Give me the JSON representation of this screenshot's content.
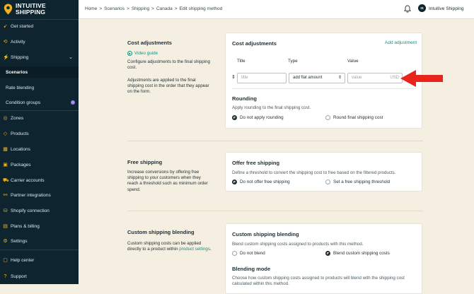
{
  "brand": {
    "name_line1": "INTUITIVE",
    "name_line2": "SHIPPING"
  },
  "sidebar": {
    "items": [
      {
        "label": "Get started",
        "icon": "rocket-icon"
      },
      {
        "label": "Activity",
        "icon": "activity-icon"
      },
      {
        "label": "Shipping",
        "icon": "shipping-icon"
      },
      {
        "label": "Scenarios"
      },
      {
        "label": "Rate blending"
      },
      {
        "label": "Condition groups",
        "badge": "i"
      },
      {
        "label": "Zones",
        "icon": "zones-icon"
      },
      {
        "label": "Products",
        "icon": "products-icon"
      },
      {
        "label": "Locations",
        "icon": "locations-icon"
      },
      {
        "label": "Packages",
        "icon": "packages-icon"
      },
      {
        "label": "Carrier accounts",
        "icon": "carrier-icon"
      },
      {
        "label": "Partner integrations",
        "icon": "partner-icon"
      },
      {
        "label": "Shopify connection",
        "icon": "shopify-icon"
      },
      {
        "label": "Plans & billing",
        "icon": "billing-icon"
      },
      {
        "label": "Settings",
        "icon": "gear-icon"
      },
      {
        "label": "Help center",
        "icon": "help-icon"
      },
      {
        "label": "Support",
        "icon": "support-icon"
      }
    ]
  },
  "header": {
    "breadcrumb": [
      "Home",
      "Scenarios",
      "Shipping",
      "Canada",
      "Edit shipping method"
    ],
    "sep": ">",
    "avatar": "IS",
    "user": "Intuitive Shipping"
  },
  "cost": {
    "title": "Cost adjustments",
    "video": "Video guide",
    "desc1": "Configure adjustments to the final shipping cost.",
    "desc2": "Adjustments are applied to the final shipping cost in the order that they appear on the form.",
    "card_title": "Cost adjustments",
    "add": "Add adjustment",
    "col_title": "Title",
    "col_type": "Type",
    "col_value": "Value",
    "title_ph": "title",
    "type_val": "add flat amount",
    "value_ph": "value",
    "unit": "USD",
    "rounding_title": "Rounding",
    "rounding_sub": "Apply rounding to the final shipping cost.",
    "r1": "Do not apply rounding",
    "r2": "Round final shipping cost"
  },
  "free": {
    "title": "Free shipping",
    "desc": "Increase conversions by offering free shipping to your customers when they reach a threshold such as minimum order spend.",
    "card_title": "Offer free shipping",
    "card_sub": "Define a threshold to convert the shipping cost to free based on the filtered products.",
    "r1": "Do not offer free shipping",
    "r2": "Set a free shipping threshold"
  },
  "blend": {
    "title": "Custom shipping blending",
    "desc_pre": "Custom shipping costs can be applied directly to a product within",
    "desc_link": "product settings",
    "desc_post": ".",
    "card_title": "Custom shipping blending",
    "card_sub": "Blend custom shipping costs assigned to products with this method.",
    "r1": "Do not blend",
    "r2": "Blend custom shipping costs",
    "mode_title": "Blending mode",
    "mode_sub": "Choose how custom shipping costs assigned to products will blend with the shipping cost calculated within this method."
  },
  "colors": {
    "sidebar": "#0e2530",
    "accent": "#f2b21d",
    "link": "#1e8f7e",
    "arrow": "#e8241b",
    "page": "#f5efe2"
  }
}
